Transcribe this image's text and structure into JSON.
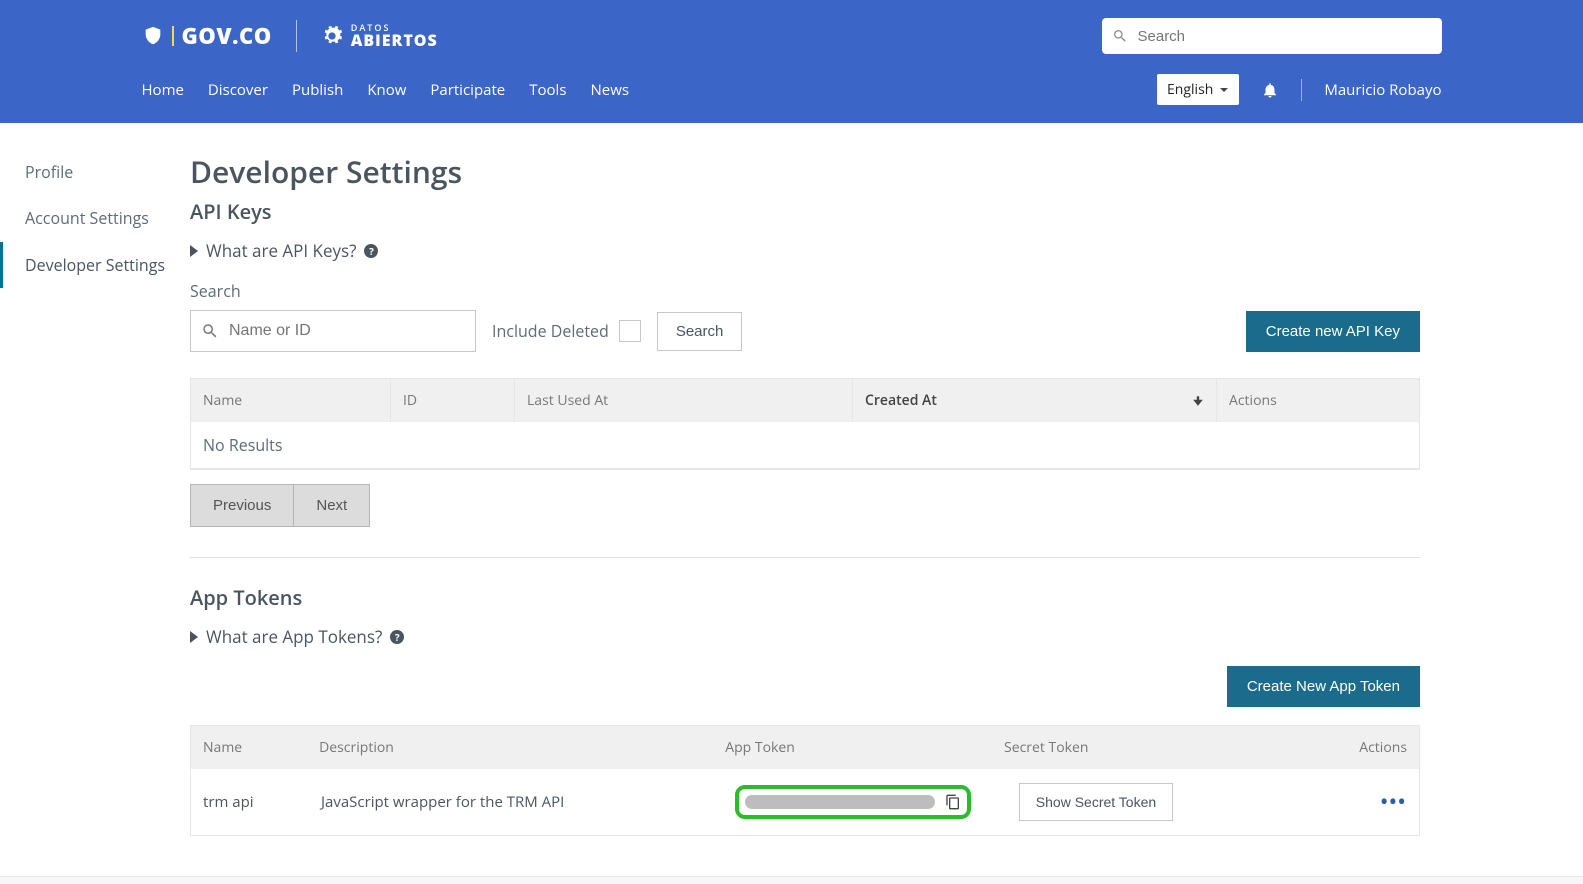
{
  "header": {
    "gov_label": "GOV.CO",
    "datos_small": "DATOS",
    "datos_big": "ABIERTOS",
    "search_placeholder": "Search",
    "language": "English",
    "username": "Mauricio Robayo"
  },
  "nav": {
    "items": [
      "Home",
      "Discover",
      "Publish",
      "Know",
      "Participate",
      "Tools",
      "News"
    ]
  },
  "sidebar": {
    "items": [
      {
        "label": "Profile",
        "active": false
      },
      {
        "label": "Account Settings",
        "active": false
      },
      {
        "label": "Developer Settings",
        "active": true
      }
    ]
  },
  "page": {
    "title": "Developer Settings"
  },
  "apiKeys": {
    "title": "API Keys",
    "disclosure": "What are API Keys?",
    "search_label": "Search",
    "search_placeholder": "Name or ID",
    "include_deleted_label": "Include Deleted",
    "search_button": "Search",
    "create_button": "Create new API Key",
    "columns": {
      "name": "Name",
      "id": "ID",
      "last_used": "Last Used At",
      "created": "Created At",
      "actions": "Actions"
    },
    "no_results": "No Results",
    "pager": {
      "prev": "Previous",
      "next": "Next"
    }
  },
  "appTokens": {
    "title": "App Tokens",
    "disclosure": "What are App Tokens?",
    "create_button": "Create New App Token",
    "columns": {
      "name": "Name",
      "description": "Description",
      "app_token": "App Token",
      "secret_token": "Secret Token",
      "actions": "Actions"
    },
    "rows": [
      {
        "name": "trm api",
        "description": "JavaScript wrapper for the TRM API",
        "show_secret_label": "Show Secret Token"
      }
    ]
  }
}
